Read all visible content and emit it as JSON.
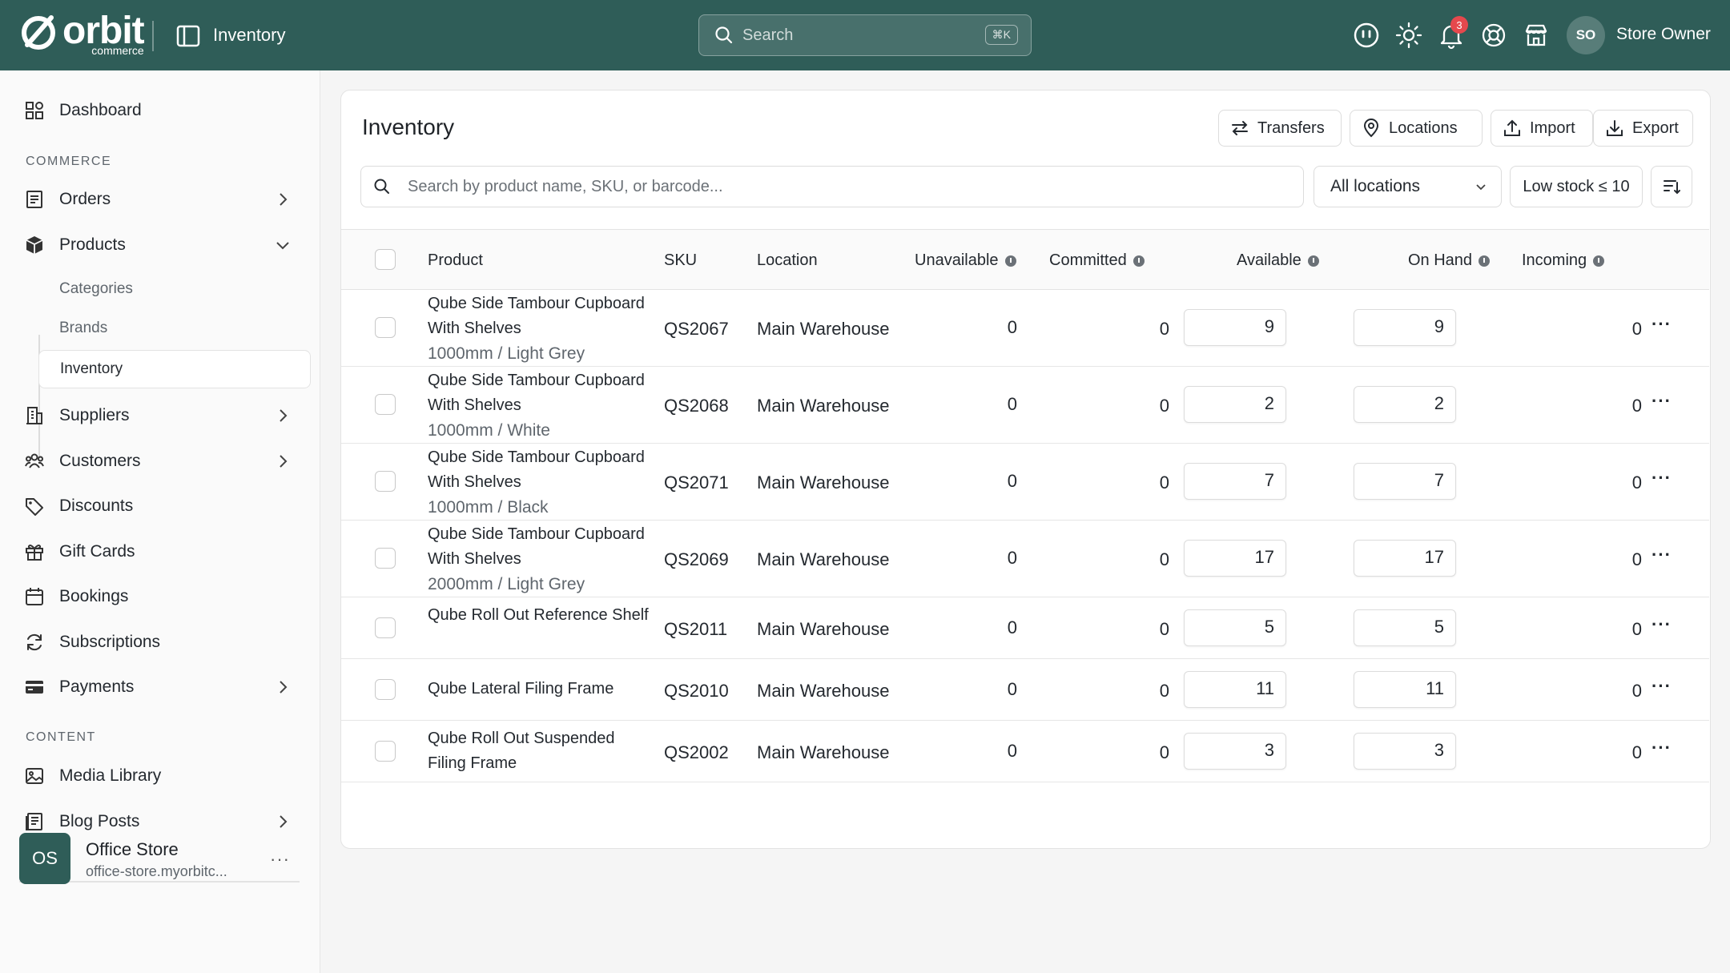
{
  "topbar": {
    "brand": "orbit",
    "brand_sub": "commerce",
    "section_title": "Inventory",
    "search_placeholder": "Search",
    "search_shortcut": "⌘K",
    "notification_count": "3",
    "user_initials": "SO",
    "user_name": "Store Owner"
  },
  "sidebar": {
    "dashboard": "Dashboard",
    "section_commerce": "COMMERCE",
    "orders": "Orders",
    "products": "Products",
    "product_sub": [
      "Categories",
      "Brands",
      "Inventory"
    ],
    "suppliers": "Suppliers",
    "customers": "Customers",
    "discounts": "Discounts",
    "gift_cards": "Gift Cards",
    "bookings": "Bookings",
    "subscriptions": "Subscriptions",
    "payments": "Payments",
    "section_content": "CONTENT",
    "media_library": "Media Library",
    "blog_posts": "Blog Posts",
    "store_initials": "OS",
    "store_name": "Office Store",
    "store_url": "office-store.myorbitc..."
  },
  "main": {
    "title": "Inventory",
    "buttons": {
      "transfers": "Transfers",
      "locations": "Locations",
      "import": "Import",
      "export": "Export"
    },
    "search_placeholder": "Search by product name, SKU, or barcode...",
    "location_filter": "All locations",
    "low_stock_filter": "Low stock ≤ 10",
    "columns": {
      "product": "Product",
      "sku": "SKU",
      "location": "Location",
      "unavailable": "Unavailable",
      "committed": "Committed",
      "available": "Available",
      "on_hand": "On Hand",
      "incoming": "Incoming"
    },
    "rows": [
      {
        "name": "Qube Side Tambour Cupboard With Shelves",
        "variant": "1000mm / Light Grey",
        "sku": "QS2067",
        "location": "Main Warehouse",
        "unavailable": "0",
        "committed": "0",
        "available": "9",
        "on_hand": "9",
        "incoming": "0"
      },
      {
        "name": "Qube Side Tambour Cupboard With Shelves",
        "variant": "1000mm / White",
        "sku": "QS2068",
        "location": "Main Warehouse",
        "unavailable": "0",
        "committed": "0",
        "available": "2",
        "on_hand": "2",
        "incoming": "0"
      },
      {
        "name": "Qube Side Tambour Cupboard With Shelves",
        "variant": "1000mm / Black",
        "sku": "QS2071",
        "location": "Main Warehouse",
        "unavailable": "0",
        "committed": "0",
        "available": "7",
        "on_hand": "7",
        "incoming": "0"
      },
      {
        "name": "Qube Side Tambour Cupboard With Shelves",
        "variant": "2000mm / Light Grey",
        "sku": "QS2069",
        "location": "Main Warehouse",
        "unavailable": "0",
        "committed": "0",
        "available": "17",
        "on_hand": "17",
        "incoming": "0"
      },
      {
        "name": "Qube Roll Out Reference Shelf",
        "variant": "",
        "sku": "QS2011",
        "location": "Main Warehouse",
        "unavailable": "0",
        "committed": "0",
        "available": "5",
        "on_hand": "5",
        "incoming": "0"
      },
      {
        "name": "Qube Lateral Filing Frame",
        "variant": "",
        "sku": "QS2010",
        "location": "Main Warehouse",
        "unavailable": "0",
        "committed": "0",
        "available": "11",
        "on_hand": "11",
        "incoming": "0"
      },
      {
        "name": "Qube Roll Out Suspended Filing Frame",
        "variant": "",
        "sku": "QS2002",
        "location": "Main Warehouse",
        "unavailable": "0",
        "committed": "0",
        "available": "3",
        "on_hand": "3",
        "incoming": "0"
      }
    ]
  },
  "colors": {
    "brand": "#2f5d58",
    "badge": "#e5484d"
  }
}
